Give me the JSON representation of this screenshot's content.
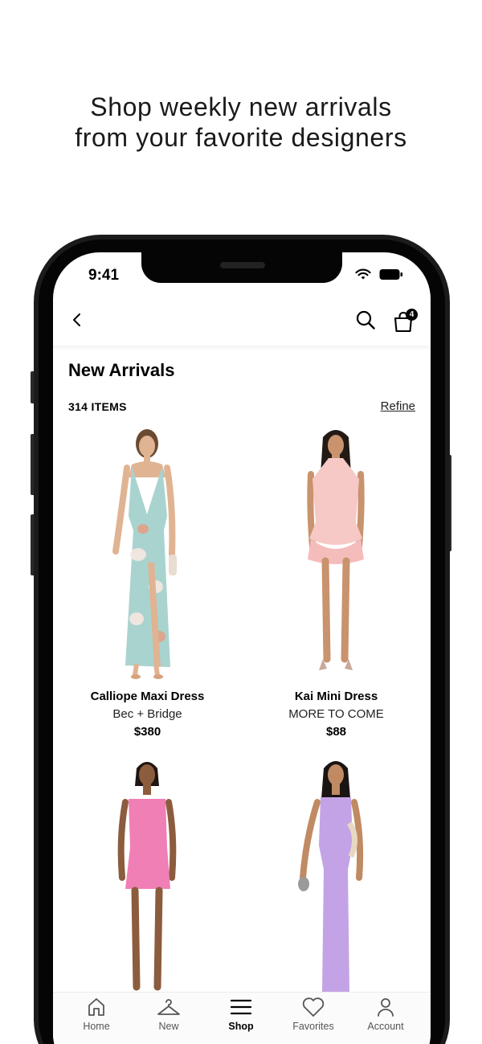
{
  "headline": {
    "line1": "Shop weekly new arrivals",
    "line2": "from your favorite designers"
  },
  "status_bar": {
    "time": "9:41",
    "icons": [
      "wifi-icon",
      "battery-icon"
    ]
  },
  "header": {
    "back_icon": "chevron-left-icon",
    "search_icon": "search-icon",
    "bag_icon": "shopping-bag-icon",
    "bag_count": "4"
  },
  "listing": {
    "title": "New Arrivals",
    "item_count": "314 ITEMS",
    "refine_label": "Refine"
  },
  "products": [
    {
      "name": "Calliope Maxi Dress",
      "brand": "Bec + Bridge",
      "price": "$380",
      "dress_color": "#a9d3cf"
    },
    {
      "name": "Kai Mini Dress",
      "brand": "MORE TO COME",
      "price": "$88",
      "dress_color": "#f6c9c6"
    },
    {
      "name": "",
      "brand": "",
      "price": "",
      "dress_color": "#ef7fb4"
    },
    {
      "name": "",
      "brand": "",
      "price": "",
      "dress_color": "#c3a3e6"
    }
  ],
  "tabs": [
    {
      "label": "Home",
      "icon": "home-icon"
    },
    {
      "label": "New",
      "icon": "hanger-icon"
    },
    {
      "label": "Shop",
      "icon": "menu-icon",
      "active": true
    },
    {
      "label": "Favorites",
      "icon": "heart-icon"
    },
    {
      "label": "Account",
      "icon": "person-icon"
    }
  ]
}
